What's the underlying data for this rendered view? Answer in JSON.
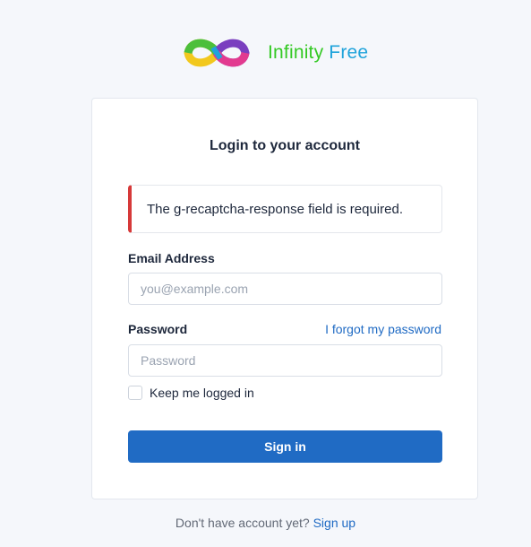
{
  "brand": {
    "logo_icon": "infinity-logo-icon",
    "name_part1": "Infinity",
    "name_part2": "Free",
    "color_part1": "#34c924",
    "color_part2": "#1fa3db"
  },
  "card": {
    "title": "Login to your account"
  },
  "alert": {
    "message": "The g-recaptcha-response field is required.",
    "color": "#d63939"
  },
  "email": {
    "label": "Email Address",
    "placeholder": "you@example.com",
    "value": ""
  },
  "password": {
    "label": "Password",
    "placeholder": "Password",
    "value": "",
    "forgot_link": "I forgot my password"
  },
  "remember": {
    "label": "Keep me logged in",
    "checked": false
  },
  "submit": {
    "label": "Sign in",
    "color": "#206bc4"
  },
  "footer": {
    "prompt": "Don't have account yet?",
    "link": "Sign up"
  }
}
